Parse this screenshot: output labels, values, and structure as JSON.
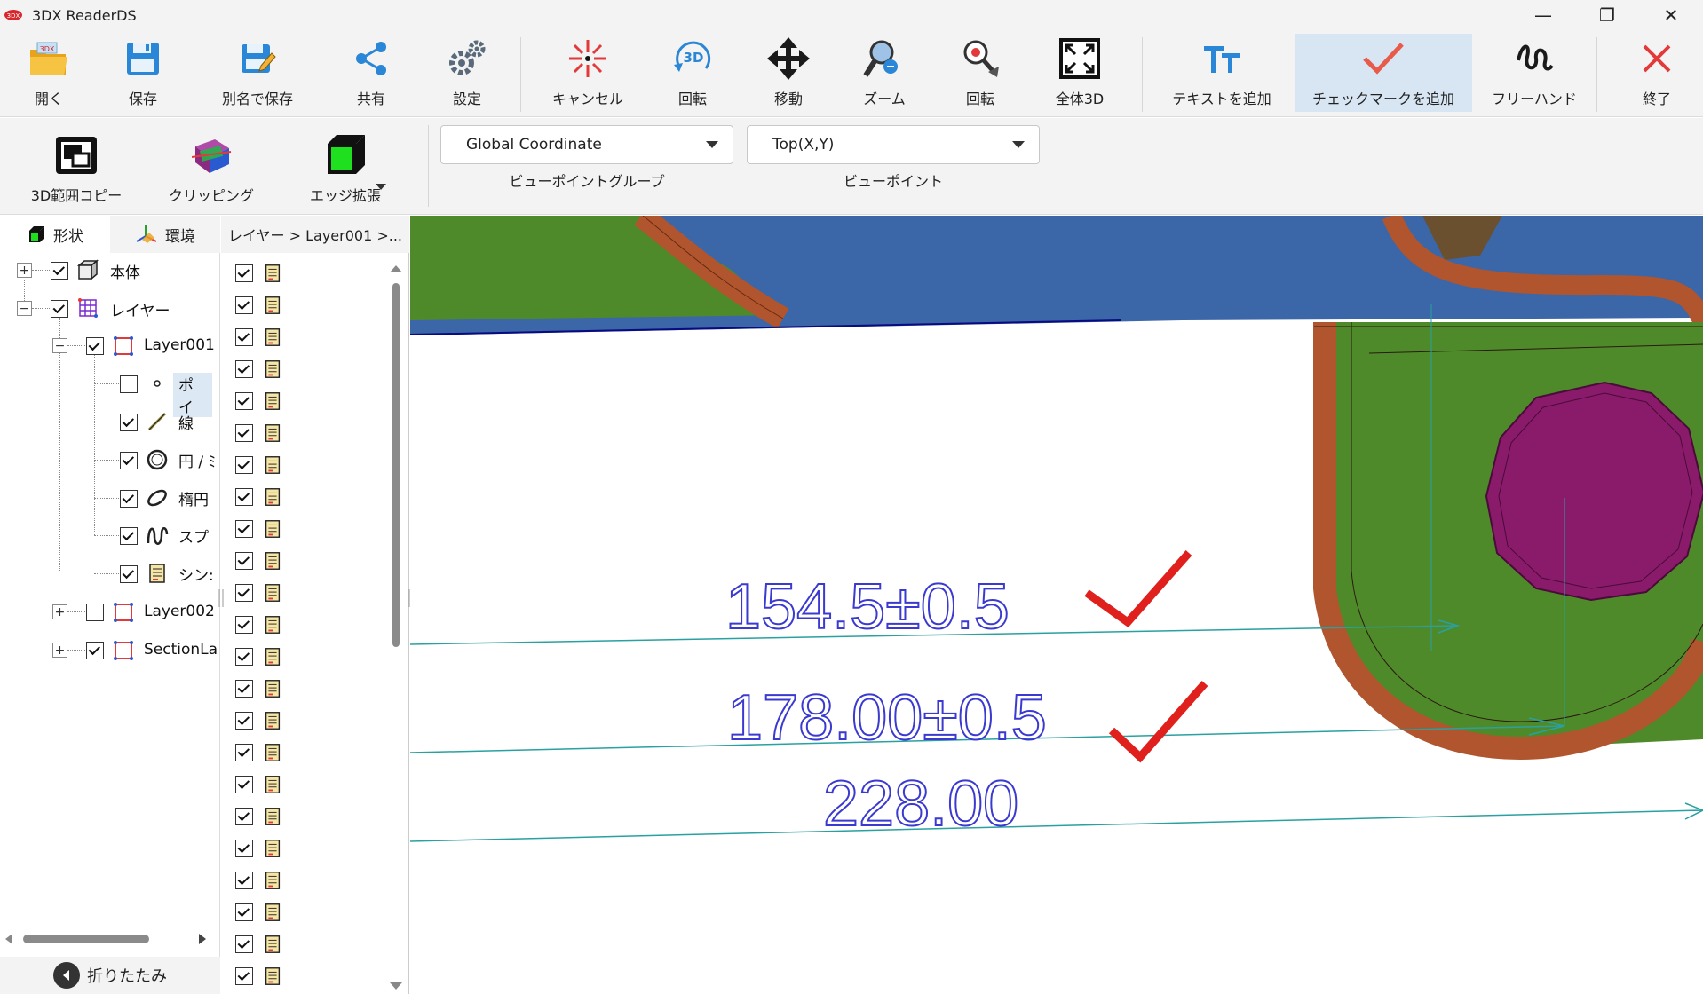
{
  "window": {
    "title": "3DX ReaderDS",
    "logo_text": "3DX",
    "controls": [
      "—",
      "❐",
      "✕"
    ]
  },
  "toolbar": {
    "open": "開く",
    "save": "保存",
    "save_as": "別名で保存",
    "share": "共有",
    "settings": "設定",
    "cancel": "キャンセル",
    "rotate3d": "回転",
    "move": "移動",
    "zoom": "ズーム",
    "rotate": "回転",
    "fit3d": "全体3D",
    "add_text": "テキストを追加",
    "add_checkmark": "チェックマークを追加",
    "freehand": "フリーハンド",
    "exit": "終了"
  },
  "toolbar2": {
    "copy3d": "3D範囲コピー",
    "clipping": "クリッピング",
    "edge_expand": "エッジ拡張",
    "viewpoint_group": {
      "value": "Global Coordinate",
      "label": "ビューポイントグループ"
    },
    "viewpoint": {
      "value": "Top(X,Y)",
      "label": "ビューポイント"
    }
  },
  "left_panel": {
    "tabs": [
      "形状",
      "環境"
    ],
    "tree": {
      "body": "本体",
      "layers": "レイヤー",
      "layer001": "Layer001",
      "points": "ポイ",
      "lines": "線",
      "circles": "円 / ﾐ",
      "ellipses": "楕円",
      "splines": "スプ",
      "symbols": "シン:",
      "layer002": "Layer002",
      "section": "SectionLa"
    },
    "collapse": "折りたたみ"
  },
  "middle_panel": {
    "header": "レイヤー > Layer001 >...",
    "row_count": 23
  },
  "viewport": {
    "dimensions": [
      "154.5±0.5",
      "178.00±0.5",
      "228.00"
    ],
    "colors": {
      "blue_part": "#3b66a8",
      "green_part": "#4f8a2a",
      "copper_edge": "#b0552d",
      "purple_hole": "#8a1b6a",
      "dim_text": "#3a3ad0",
      "dim_line": "#2aa0a0",
      "check": "#e0201c"
    }
  }
}
